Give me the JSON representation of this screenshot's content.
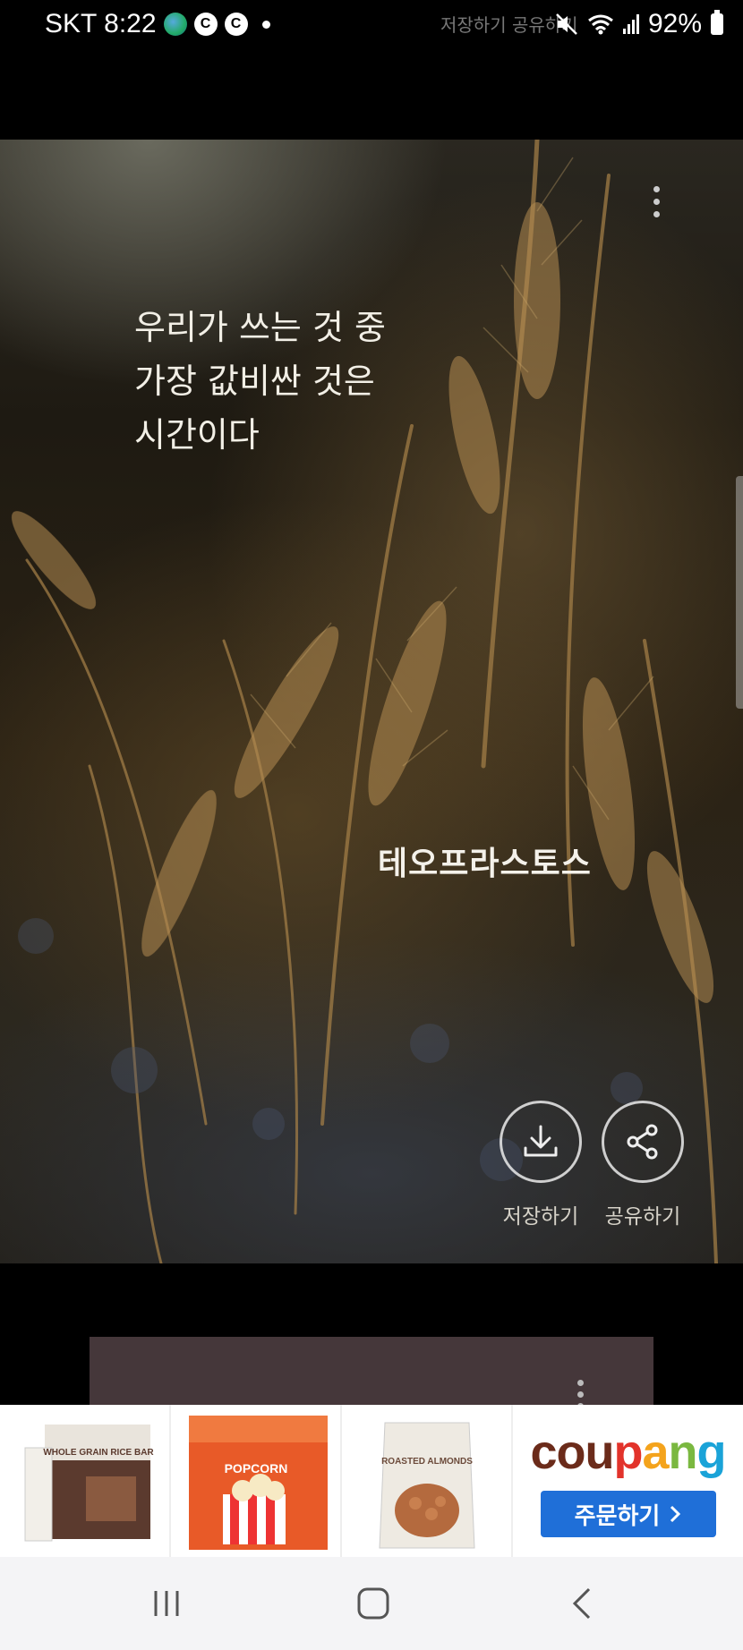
{
  "status_bar": {
    "carrier_time": "SKT 8:22",
    "cc1": "C",
    "cc2": "C",
    "ghost_text": "저장하기  공유하기",
    "battery": "92%"
  },
  "quote_card": {
    "quote": "우리가 쓰는 것 중\n 가장 값비싼 것은\n 시간이다",
    "author": "테오프라스토스",
    "save_label": "저장하기",
    "share_label": "공유하기"
  },
  "ad": {
    "products": [
      "WHOLE GRAIN RICE BAR",
      "POPCORN",
      "ROASTED ALMONDS"
    ],
    "brand_letters": [
      "c",
      "o",
      "u",
      "p",
      "a",
      "n",
      "g"
    ],
    "brand_colors": [
      "#6b2b1a",
      "#6b2b1a",
      "#6b2b1a",
      "#e2332b",
      "#f4a31c",
      "#7ab840",
      "#1aa3d8"
    ],
    "order_label": "주문하기",
    "order_color": "#1f6fd8"
  },
  "icons": {
    "save": "download-icon",
    "share": "share-icon",
    "recents": "recent-apps-icon",
    "home": "home-icon",
    "back": "back-icon"
  }
}
